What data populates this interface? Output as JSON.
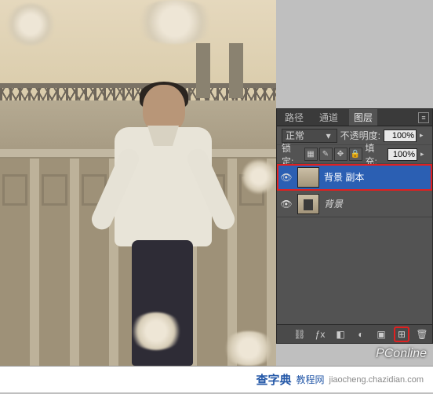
{
  "panel": {
    "tabs": {
      "paths": "路径",
      "channels": "通道",
      "layers": "图层"
    },
    "blend_mode": "正常",
    "opacity_label": "不透明度:",
    "opacity_value": "100%",
    "lock_label": "锁定:",
    "fill_label": "填充:",
    "fill_value": "100%"
  },
  "layers": [
    {
      "name": "背景 副本",
      "selected": true
    },
    {
      "name": "背景",
      "selected": false
    }
  ],
  "watermarks": {
    "pconline": "PConline",
    "site_cn": "查字典",
    "site_suffix": "教程网",
    "domain": "jiaocheng.chazidian.com"
  }
}
